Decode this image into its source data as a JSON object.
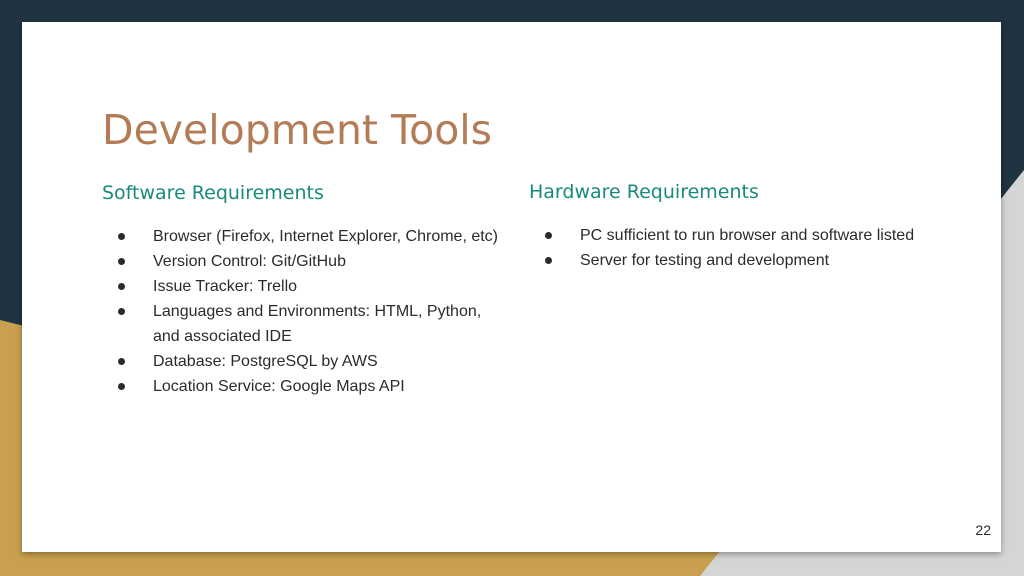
{
  "slide": {
    "title": "Development Tools",
    "page_number": "22",
    "colors": {
      "title": "#b47c56",
      "heading": "#1a8a7a",
      "background_dark": "#1f3440",
      "background_gold": "#c9a04f",
      "background_gray": "#d5d5d5"
    }
  },
  "software": {
    "heading": "Software Requirements",
    "items": [
      "Browser (Firefox, Internet Explorer, Chrome, etc)",
      "Version Control: Git/GitHub",
      "Issue Tracker: Trello",
      "Languages and Environments: HTML, Python, and associated IDE",
      "Database: PostgreSQL by AWS",
      "Location Service: Google Maps API"
    ]
  },
  "hardware": {
    "heading": "Hardware Requirements",
    "items": [
      "PC sufficient to run browser and software listed",
      "Server for testing and development"
    ]
  }
}
